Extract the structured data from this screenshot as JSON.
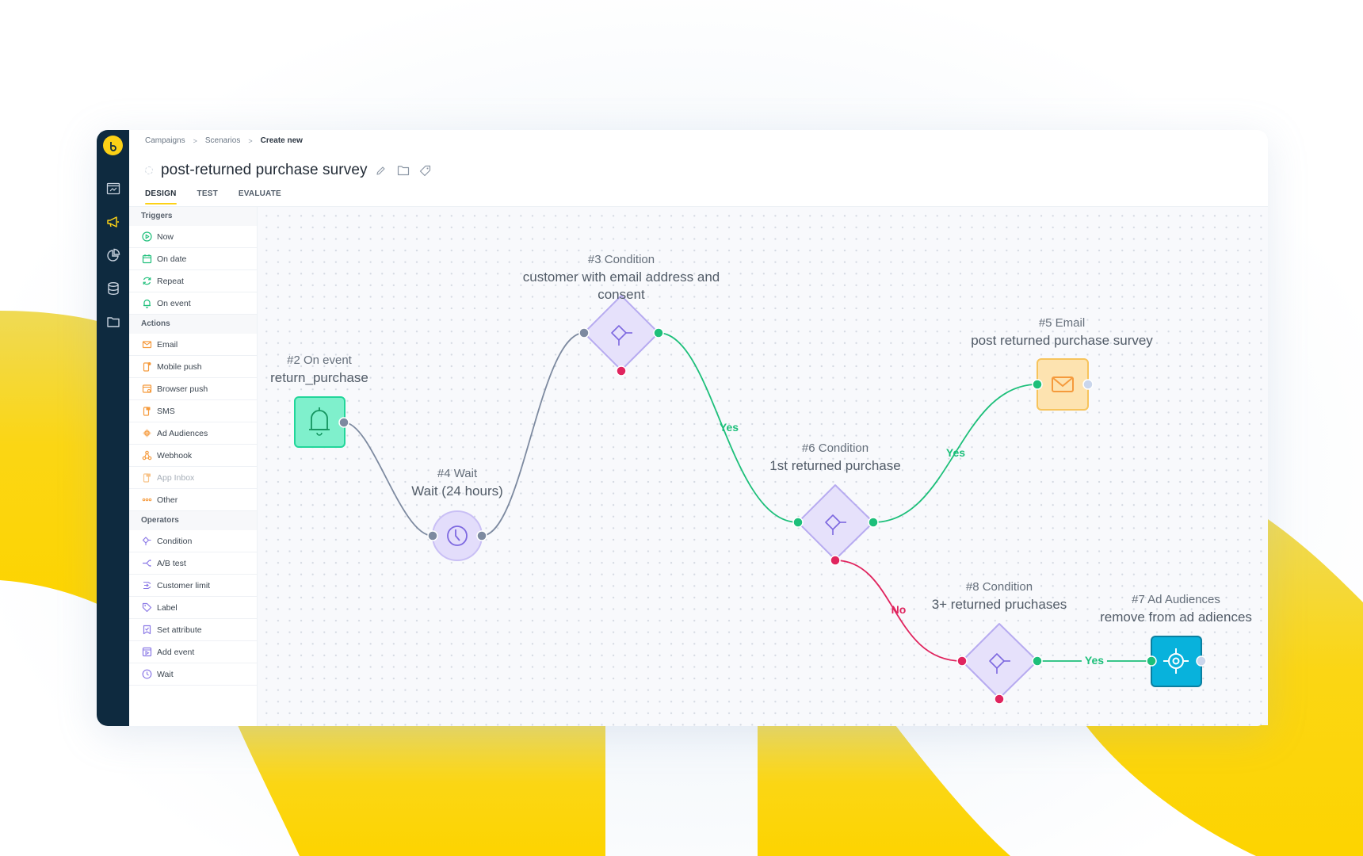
{
  "brand": {
    "accent": "#fcd116",
    "rail_bg": "#0e2a3f"
  },
  "rail": {
    "items": [
      {
        "icon": "dashboard-icon",
        "active": false
      },
      {
        "icon": "megaphone-icon",
        "active": true
      },
      {
        "icon": "pie-chart-icon",
        "active": false
      },
      {
        "icon": "database-icon",
        "active": false
      },
      {
        "icon": "folder-icon",
        "active": false
      }
    ]
  },
  "breadcrumb": [
    "Campaigns",
    "Scenarios",
    "Create new"
  ],
  "breadcrumb_sep": ">",
  "title": "post-returned purchase survey",
  "title_icons": [
    "pencil-icon",
    "folder-icon",
    "tag-icon"
  ],
  "tabs": [
    {
      "label": "DESIGN",
      "active": true
    },
    {
      "label": "TEST",
      "active": false
    },
    {
      "label": "EVALUATE",
      "active": false
    }
  ],
  "panel": {
    "triggers": {
      "label": "Triggers",
      "items": [
        {
          "label": "Now",
          "icon": "play-circle-icon"
        },
        {
          "label": "On date",
          "icon": "calendar-icon"
        },
        {
          "label": "Repeat",
          "icon": "repeat-icon"
        },
        {
          "label": "On event",
          "icon": "bell-icon"
        }
      ]
    },
    "actions": {
      "label": "Actions",
      "items": [
        {
          "label": "Email",
          "icon": "envelope-icon"
        },
        {
          "label": "Mobile push",
          "icon": "mobile-push-icon"
        },
        {
          "label": "Browser push",
          "icon": "browser-push-icon"
        },
        {
          "label": "SMS",
          "icon": "sms-icon"
        },
        {
          "label": "Ad Audiences",
          "icon": "target-icon"
        },
        {
          "label": "Webhook",
          "icon": "webhook-icon"
        },
        {
          "label": "App Inbox",
          "icon": "app-inbox-icon",
          "disabled": true
        },
        {
          "label": "Other",
          "icon": "dots-icon"
        }
      ]
    },
    "operators": {
      "label": "Operators",
      "items": [
        {
          "label": "Condition",
          "icon": "condition-icon"
        },
        {
          "label": "A/B test",
          "icon": "ab-test-icon"
        },
        {
          "label": "Customer limit",
          "icon": "customer-limit-icon"
        },
        {
          "label": "Label",
          "icon": "tag-icon"
        },
        {
          "label": "Set attribute",
          "icon": "set-attribute-icon"
        },
        {
          "label": "Add event",
          "icon": "add-event-icon"
        },
        {
          "label": "Wait",
          "icon": "clock-icon"
        }
      ]
    }
  },
  "flow": {
    "nodes": [
      {
        "id": "n2",
        "heading": "#2 On event",
        "subtitle": "return_purchase",
        "type": "trigger",
        "icon": "bell-icon"
      },
      {
        "id": "n4",
        "heading": "#4 Wait",
        "subtitle": "Wait (24 hours)",
        "type": "wait",
        "icon": "clock-icon"
      },
      {
        "id": "n3",
        "heading": "#3 Condition",
        "subtitle": "customer with email address and",
        "subtitle2": "consent",
        "type": "condition",
        "icon": "condition-icon"
      },
      {
        "id": "n6",
        "heading": "#6 Condition",
        "subtitle": "1st returned purchase",
        "type": "condition",
        "icon": "condition-icon"
      },
      {
        "id": "n5",
        "heading": "#5 Email",
        "subtitle": "post returned purchase survey",
        "type": "email",
        "icon": "envelope-icon"
      },
      {
        "id": "n8",
        "heading": "#8 Condition",
        "subtitle": "3+ returned pruchases",
        "type": "condition",
        "icon": "condition-icon"
      },
      {
        "id": "n7",
        "heading": "#7 Ad Audiences",
        "subtitle": "remove from ad adiences",
        "type": "ad-audiences",
        "icon": "target-icon"
      }
    ],
    "edges": [
      {
        "from": "n2",
        "to": "n4",
        "label": "",
        "kind": "default"
      },
      {
        "from": "n4",
        "to": "n3",
        "label": "",
        "kind": "default"
      },
      {
        "from": "n3",
        "to": "n6",
        "label": "Yes",
        "kind": "yes"
      },
      {
        "from": "n6",
        "to": "n5",
        "label": "Yes",
        "kind": "yes"
      },
      {
        "from": "n6",
        "to": "n8",
        "label": "No",
        "kind": "no"
      },
      {
        "from": "n8",
        "to": "n7",
        "label": "Yes",
        "kind": "yes"
      }
    ],
    "colors": {
      "yes": "#1dbf7a",
      "no": "#e0245e",
      "default": "#7d8aa0",
      "condition_fill": "#e6e1fb",
      "condition_stroke": "#b7abf0",
      "trigger_fill": "#7ff0cc",
      "trigger_stroke": "#22d69a",
      "email_fill": "#fde3b0",
      "email_stroke": "#f7c45c",
      "ad_fill": "#08b2dc",
      "ad_stroke": "#0a7fa0"
    }
  }
}
